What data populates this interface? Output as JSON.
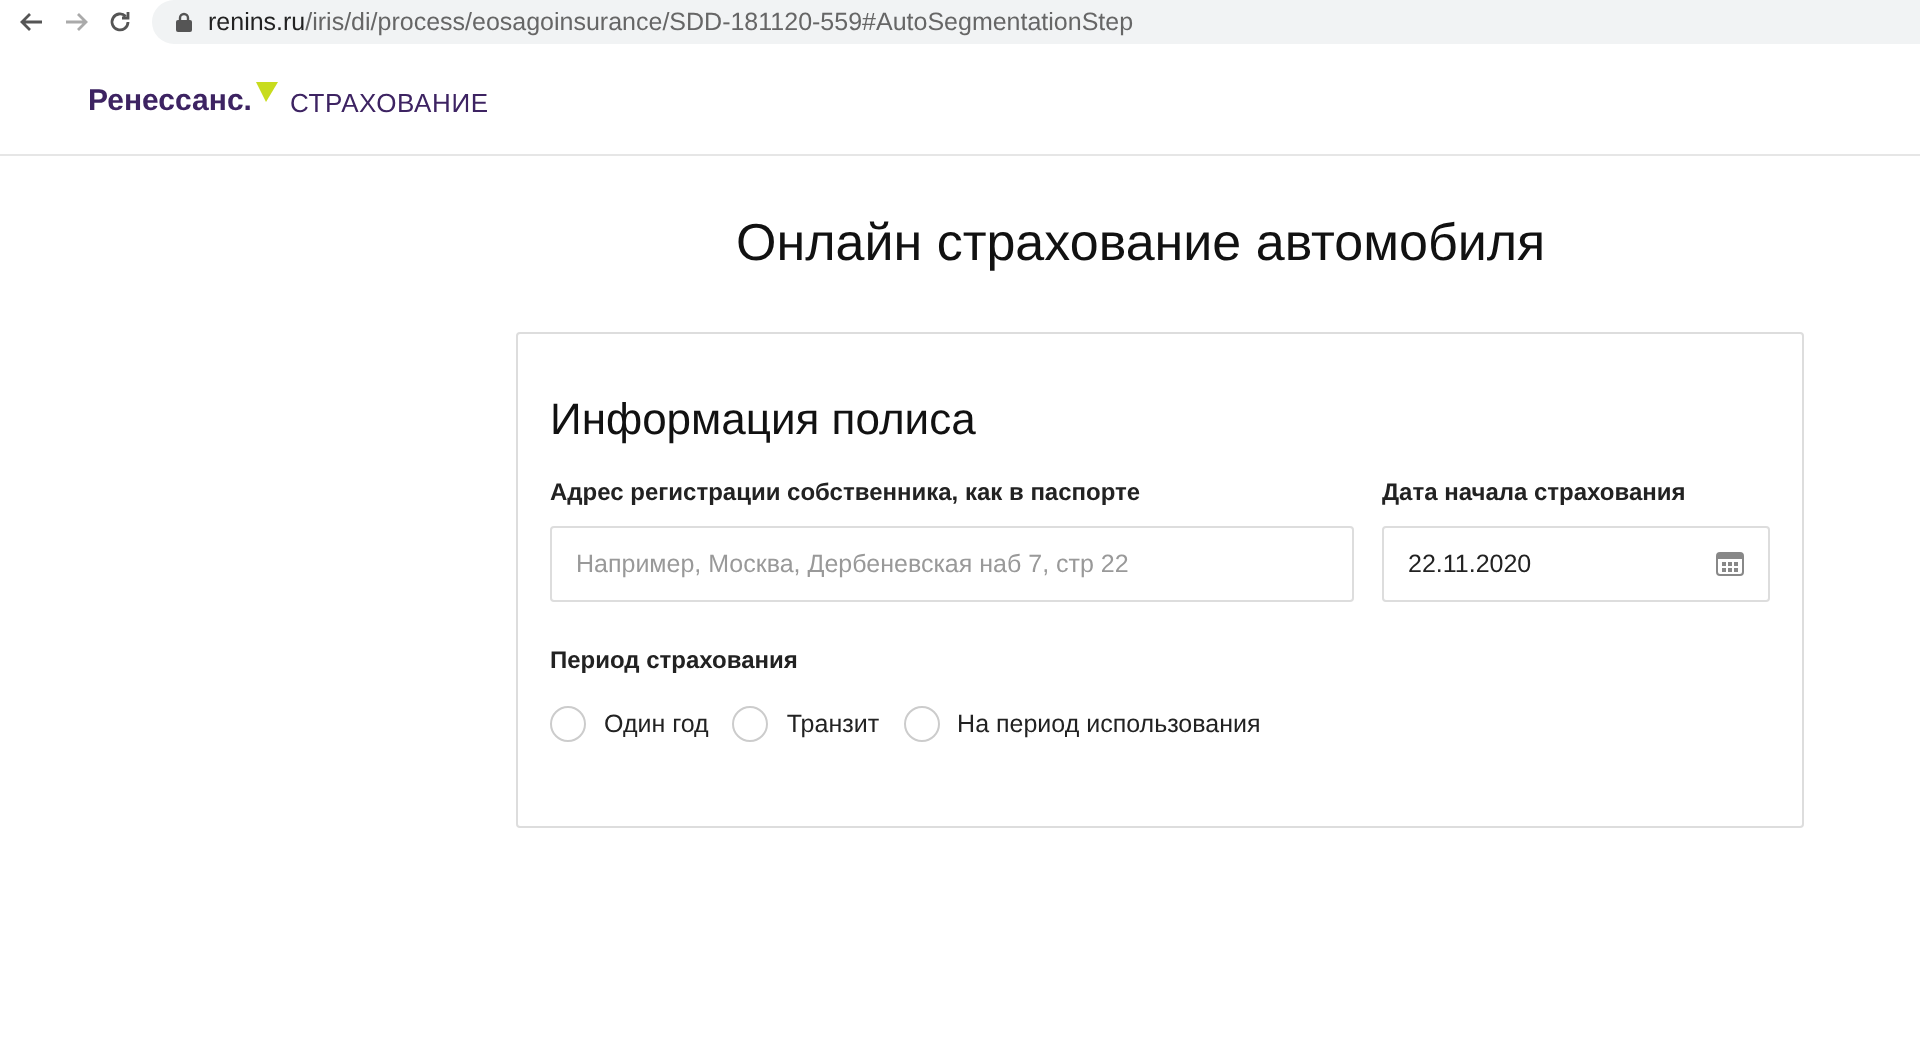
{
  "browser": {
    "url_host": "renins.ru",
    "url_path": "/iris/di/process/eosagoinsurance/SDD-181120-559#AutoSegmentationStep"
  },
  "logo": {
    "brand": "Ренессанс.",
    "product": "СТРАХОВАНИЕ"
  },
  "page_title": "Онлайн страхование автомобиля",
  "card": {
    "title": "Информация полиса",
    "address": {
      "label": "Адрес регистрации собственника, как в паспорте",
      "placeholder": "Например, Москва, Дербеневская наб 7, стр 22"
    },
    "start_date": {
      "label": "Дата начала страхования",
      "value": "22.11.2020"
    },
    "period": {
      "label": "Период страхования",
      "options": [
        {
          "label": "Один год",
          "selected": false
        },
        {
          "label": "Транзит",
          "selected": false
        },
        {
          "label": "На период использования",
          "selected": false
        }
      ]
    }
  }
}
